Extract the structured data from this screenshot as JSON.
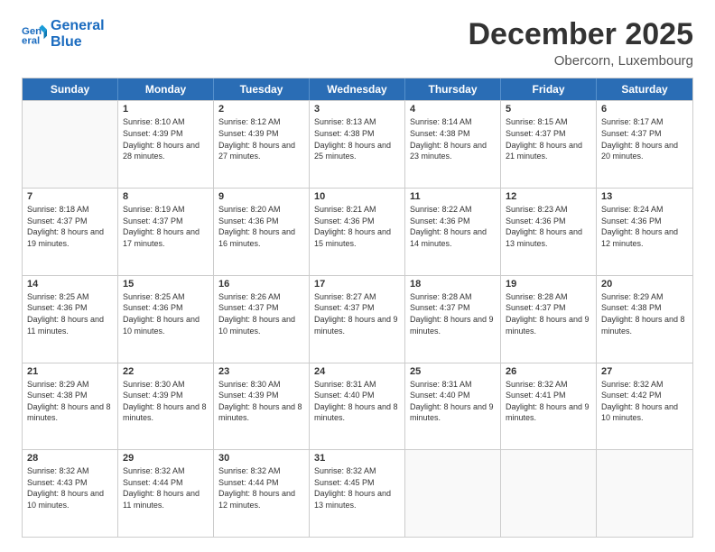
{
  "logo": {
    "line1": "General",
    "line2": "Blue"
  },
  "title": "December 2025",
  "subtitle": "Obercorn, Luxembourg",
  "days_of_week": [
    "Sunday",
    "Monday",
    "Tuesday",
    "Wednesday",
    "Thursday",
    "Friday",
    "Saturday"
  ],
  "weeks": [
    [
      {
        "day": "",
        "sunrise": "",
        "sunset": "",
        "daylight": "",
        "empty": true
      },
      {
        "day": "1",
        "sunrise": "Sunrise: 8:10 AM",
        "sunset": "Sunset: 4:39 PM",
        "daylight": "Daylight: 8 hours and 28 minutes."
      },
      {
        "day": "2",
        "sunrise": "Sunrise: 8:12 AM",
        "sunset": "Sunset: 4:39 PM",
        "daylight": "Daylight: 8 hours and 27 minutes."
      },
      {
        "day": "3",
        "sunrise": "Sunrise: 8:13 AM",
        "sunset": "Sunset: 4:38 PM",
        "daylight": "Daylight: 8 hours and 25 minutes."
      },
      {
        "day": "4",
        "sunrise": "Sunrise: 8:14 AM",
        "sunset": "Sunset: 4:38 PM",
        "daylight": "Daylight: 8 hours and 23 minutes."
      },
      {
        "day": "5",
        "sunrise": "Sunrise: 8:15 AM",
        "sunset": "Sunset: 4:37 PM",
        "daylight": "Daylight: 8 hours and 21 minutes."
      },
      {
        "day": "6",
        "sunrise": "Sunrise: 8:17 AM",
        "sunset": "Sunset: 4:37 PM",
        "daylight": "Daylight: 8 hours and 20 minutes."
      }
    ],
    [
      {
        "day": "7",
        "sunrise": "Sunrise: 8:18 AM",
        "sunset": "Sunset: 4:37 PM",
        "daylight": "Daylight: 8 hours and 19 minutes."
      },
      {
        "day": "8",
        "sunrise": "Sunrise: 8:19 AM",
        "sunset": "Sunset: 4:37 PM",
        "daylight": "Daylight: 8 hours and 17 minutes."
      },
      {
        "day": "9",
        "sunrise": "Sunrise: 8:20 AM",
        "sunset": "Sunset: 4:36 PM",
        "daylight": "Daylight: 8 hours and 16 minutes."
      },
      {
        "day": "10",
        "sunrise": "Sunrise: 8:21 AM",
        "sunset": "Sunset: 4:36 PM",
        "daylight": "Daylight: 8 hours and 15 minutes."
      },
      {
        "day": "11",
        "sunrise": "Sunrise: 8:22 AM",
        "sunset": "Sunset: 4:36 PM",
        "daylight": "Daylight: 8 hours and 14 minutes."
      },
      {
        "day": "12",
        "sunrise": "Sunrise: 8:23 AM",
        "sunset": "Sunset: 4:36 PM",
        "daylight": "Daylight: 8 hours and 13 minutes."
      },
      {
        "day": "13",
        "sunrise": "Sunrise: 8:24 AM",
        "sunset": "Sunset: 4:36 PM",
        "daylight": "Daylight: 8 hours and 12 minutes."
      }
    ],
    [
      {
        "day": "14",
        "sunrise": "Sunrise: 8:25 AM",
        "sunset": "Sunset: 4:36 PM",
        "daylight": "Daylight: 8 hours and 11 minutes."
      },
      {
        "day": "15",
        "sunrise": "Sunrise: 8:25 AM",
        "sunset": "Sunset: 4:36 PM",
        "daylight": "Daylight: 8 hours and 10 minutes."
      },
      {
        "day": "16",
        "sunrise": "Sunrise: 8:26 AM",
        "sunset": "Sunset: 4:37 PM",
        "daylight": "Daylight: 8 hours and 10 minutes."
      },
      {
        "day": "17",
        "sunrise": "Sunrise: 8:27 AM",
        "sunset": "Sunset: 4:37 PM",
        "daylight": "Daylight: 8 hours and 9 minutes."
      },
      {
        "day": "18",
        "sunrise": "Sunrise: 8:28 AM",
        "sunset": "Sunset: 4:37 PM",
        "daylight": "Daylight: 8 hours and 9 minutes."
      },
      {
        "day": "19",
        "sunrise": "Sunrise: 8:28 AM",
        "sunset": "Sunset: 4:37 PM",
        "daylight": "Daylight: 8 hours and 9 minutes."
      },
      {
        "day": "20",
        "sunrise": "Sunrise: 8:29 AM",
        "sunset": "Sunset: 4:38 PM",
        "daylight": "Daylight: 8 hours and 8 minutes."
      }
    ],
    [
      {
        "day": "21",
        "sunrise": "Sunrise: 8:29 AM",
        "sunset": "Sunset: 4:38 PM",
        "daylight": "Daylight: 8 hours and 8 minutes."
      },
      {
        "day": "22",
        "sunrise": "Sunrise: 8:30 AM",
        "sunset": "Sunset: 4:39 PM",
        "daylight": "Daylight: 8 hours and 8 minutes."
      },
      {
        "day": "23",
        "sunrise": "Sunrise: 8:30 AM",
        "sunset": "Sunset: 4:39 PM",
        "daylight": "Daylight: 8 hours and 8 minutes."
      },
      {
        "day": "24",
        "sunrise": "Sunrise: 8:31 AM",
        "sunset": "Sunset: 4:40 PM",
        "daylight": "Daylight: 8 hours and 8 minutes."
      },
      {
        "day": "25",
        "sunrise": "Sunrise: 8:31 AM",
        "sunset": "Sunset: 4:40 PM",
        "daylight": "Daylight: 8 hours and 9 minutes."
      },
      {
        "day": "26",
        "sunrise": "Sunrise: 8:32 AM",
        "sunset": "Sunset: 4:41 PM",
        "daylight": "Daylight: 8 hours and 9 minutes."
      },
      {
        "day": "27",
        "sunrise": "Sunrise: 8:32 AM",
        "sunset": "Sunset: 4:42 PM",
        "daylight": "Daylight: 8 hours and 10 minutes."
      }
    ],
    [
      {
        "day": "28",
        "sunrise": "Sunrise: 8:32 AM",
        "sunset": "Sunset: 4:43 PM",
        "daylight": "Daylight: 8 hours and 10 minutes."
      },
      {
        "day": "29",
        "sunrise": "Sunrise: 8:32 AM",
        "sunset": "Sunset: 4:44 PM",
        "daylight": "Daylight: 8 hours and 11 minutes."
      },
      {
        "day": "30",
        "sunrise": "Sunrise: 8:32 AM",
        "sunset": "Sunset: 4:44 PM",
        "daylight": "Daylight: 8 hours and 12 minutes."
      },
      {
        "day": "31",
        "sunrise": "Sunrise: 8:32 AM",
        "sunset": "Sunset: 4:45 PM",
        "daylight": "Daylight: 8 hours and 13 minutes."
      },
      {
        "day": "",
        "sunrise": "",
        "sunset": "",
        "daylight": "",
        "empty": true
      },
      {
        "day": "",
        "sunrise": "",
        "sunset": "",
        "daylight": "",
        "empty": true
      },
      {
        "day": "",
        "sunrise": "",
        "sunset": "",
        "daylight": "",
        "empty": true
      }
    ]
  ]
}
